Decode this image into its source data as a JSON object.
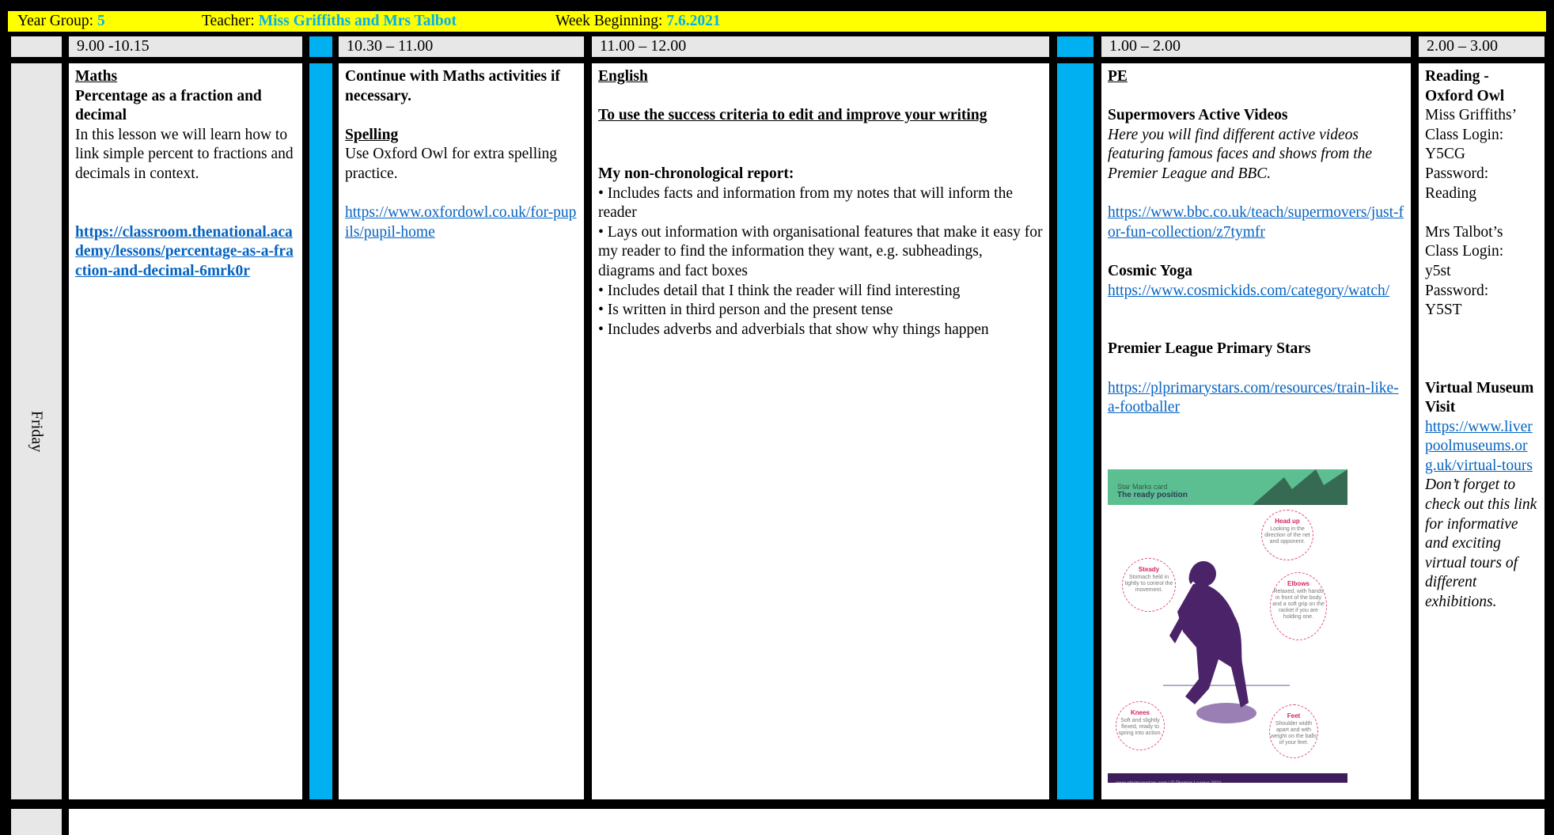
{
  "header": {
    "year_label": "Year Group: ",
    "year_value": "5",
    "teacher_label": "Teacher: ",
    "teacher_value": "Miss Griffiths and Mrs Talbot",
    "week_label": "Week Beginning: ",
    "week_value": "7.6.2021"
  },
  "times": {
    "slot1": "9.00 -10.15",
    "slot2": "10.30 – 11.00",
    "slot3": "11.00 – 12.00",
    "slot4": "1.00 – 2.00",
    "slot5": "2.00 – 3.00"
  },
  "day": "Friday",
  "maths": {
    "title": "Maths",
    "subtitle": "Percentage as a fraction and decimal",
    "body": "In this lesson we will learn how to link simple percent to fractions and decimals in context.",
    "link": "https://classroom.thenational.academy/lessons/percentage-as-a-fraction-and-decimal-6mrk0r"
  },
  "session2": {
    "intro": "Continue with Maths activities if necessary.",
    "spelling_title": "Spelling",
    "spelling_body": "Use Oxford Owl for extra spelling practice.",
    "spelling_link": "https://www.oxfordowl.co.uk/for-pupils/pupil-home"
  },
  "english": {
    "title": "English",
    "objective": "To use the success criteria to edit and improve your writing",
    "report_title": "My non-chronological report:",
    "bullets": [
      "• Includes facts and information from my notes that will inform the reader",
      "• Lays out information with organisational features that make it easy for my reader to find the information they want, e.g. subheadings, diagrams and fact boxes",
      "• Includes detail that I think the reader will find interesting",
      "• Is written in third person and the present tense",
      "• Includes adverbs and adverbials that show why things happen"
    ]
  },
  "pe": {
    "title": "PE",
    "supermovers_title": "Supermovers Active Videos",
    "supermovers_desc": "Here you will find different active videos featuring famous faces and shows from the Premier League and BBC.",
    "supermovers_link": "https://www.bbc.co.uk/teach/supermovers/just-for-fun-collection/z7tymfr",
    "yoga_title": "Cosmic Yoga",
    "yoga_link": "https://www.cosmickids.com/category/watch/",
    "plps_title": "Premier League Primary Stars",
    "plps_link": "https://plprimarystars.com/resources/train-like-a-footballer",
    "poster": {
      "card_label": "Star Marks card",
      "card_title": "The ready position",
      "bubbles": [
        {
          "title": "Head up",
          "text": "Looking in the direction of the net and opponent."
        },
        {
          "title": "Steady",
          "text": "Stomach held in tightly to control the movement."
        },
        {
          "title": "Elbows",
          "text": "Relaxed, with hands in front of the body and a soft grip on the racket if you are holding one."
        },
        {
          "title": "Knees",
          "text": "Soft and slightly flexed, ready to spring into action."
        },
        {
          "title": "Feet",
          "text": "Shoulder width apart and with weight on the balls of your feet."
        }
      ],
      "footer": "www.plprimarystars.com  |  © Premier League 2021",
      "colors": {
        "banner": "#5cbf91",
        "figure": "#4b2369",
        "accent": "#d6245c"
      }
    }
  },
  "reading": {
    "title": "Reading - Oxford Owl",
    "login1_line1": "Miss Griffiths’ Class Login:",
    "login1_user": "Y5CG",
    "login1_pass_label": "Password:",
    "login1_pass": "Reading",
    "login2_line1": "Mrs Talbot’s Class Login:",
    "login2_user": "y5st",
    "login2_pass_label": "Password:",
    "login2_pass": "Y5ST",
    "museum_title": "Virtual Museum Visit",
    "museum_link": "https://www.liverpoolmuseums.org.uk/virtual-tours",
    "museum_note": "Don’t forget to check out this link for informative and exciting virtual tours of different exhibitions."
  },
  "colors": {
    "header_bg": "#ffff00",
    "header_highlight": "#00b0f0",
    "break_col": "#00b0f0",
    "link": "#0563c1"
  }
}
